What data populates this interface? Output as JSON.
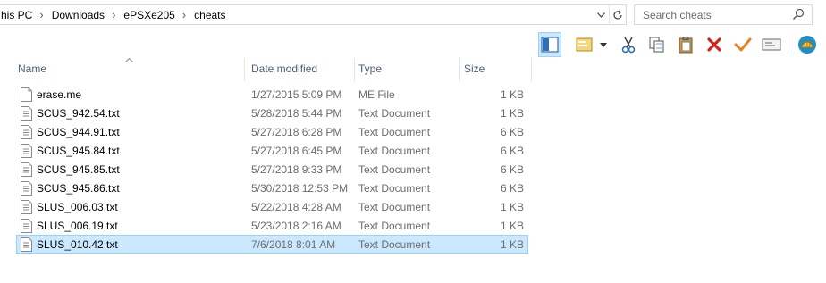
{
  "address": {
    "crumbs": [
      "his PC",
      "Downloads",
      "ePSXe205",
      "cheats"
    ]
  },
  "search": {
    "placeholder": "Search cheats"
  },
  "toolbar": {
    "items": [
      "layout-pane-icon",
      "properties-icon",
      "cut-icon",
      "copy-icon",
      "paste-icon",
      "delete-icon",
      "checkmark-icon",
      "rename-icon",
      "shell-icon"
    ]
  },
  "columns": {
    "name": "Name",
    "date": "Date modified",
    "type": "Type",
    "size": "Size"
  },
  "files": [
    {
      "name": "erase.me",
      "date": "1/27/2015 5:09 PM",
      "type": "ME File",
      "size": "1 KB"
    },
    {
      "name": "SCUS_942.54.txt",
      "date": "5/28/2018 5:44 PM",
      "type": "Text Document",
      "size": "1 KB"
    },
    {
      "name": "SCUS_944.91.txt",
      "date": "5/27/2018 6:28 PM",
      "type": "Text Document",
      "size": "6 KB"
    },
    {
      "name": "SCUS_945.84.txt",
      "date": "5/27/2018 6:45 PM",
      "type": "Text Document",
      "size": "6 KB"
    },
    {
      "name": "SCUS_945.85.txt",
      "date": "5/27/2018 9:33 PM",
      "type": "Text Document",
      "size": "6 KB"
    },
    {
      "name": "SCUS_945.86.txt",
      "date": "5/30/2018 12:53 PM",
      "type": "Text Document",
      "size": "6 KB"
    },
    {
      "name": "SLUS_006.03.txt",
      "date": "5/22/2018 4:28 AM",
      "type": "Text Document",
      "size": "1 KB"
    },
    {
      "name": "SLUS_006.19.txt",
      "date": "5/23/2018 2:16 AM",
      "type": "Text Document",
      "size": "1 KB"
    },
    {
      "name": "SLUS_010.42.txt",
      "date": "7/6/2018 8:01 AM",
      "type": "Text Document",
      "size": "1 KB",
      "selected": true
    }
  ]
}
